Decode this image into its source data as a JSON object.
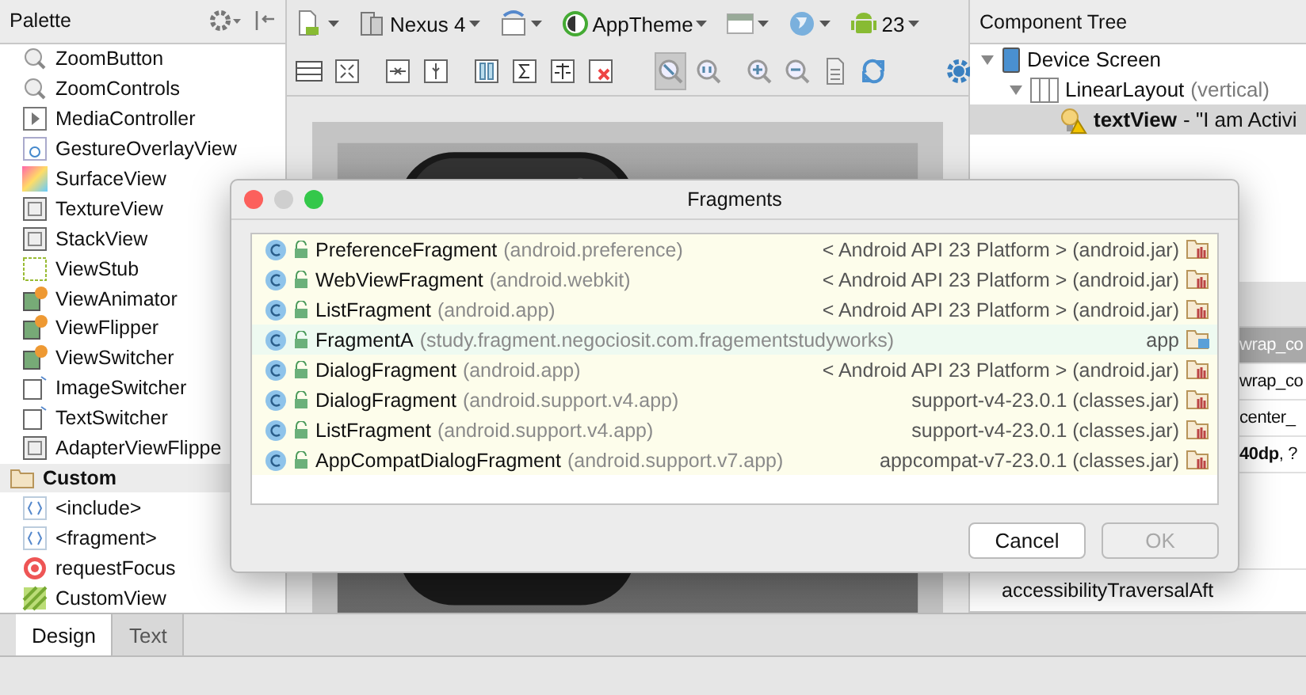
{
  "palette": {
    "title": "Palette",
    "items": [
      {
        "label": "ZoomButton",
        "kind": "zoom"
      },
      {
        "label": "ZoomControls",
        "kind": "zoom"
      },
      {
        "label": "MediaController",
        "kind": "media"
      },
      {
        "label": "GestureOverlayView",
        "kind": "gesture"
      },
      {
        "label": "SurfaceView",
        "kind": "surface"
      },
      {
        "label": "TextureView",
        "kind": "texture"
      },
      {
        "label": "StackView",
        "kind": "stack"
      },
      {
        "label": "ViewStub",
        "kind": "stub"
      },
      {
        "label": "ViewAnimator",
        "kind": "animator"
      },
      {
        "label": "ViewFlipper",
        "kind": "animator"
      },
      {
        "label": "ViewSwitcher",
        "kind": "animator"
      },
      {
        "label": "ImageSwitcher",
        "kind": "switcher"
      },
      {
        "label": "TextSwitcher",
        "kind": "switcher"
      },
      {
        "label": "AdapterViewFlippe",
        "kind": "texture"
      },
      {
        "label": "Custom",
        "kind": "section"
      },
      {
        "label": "<include>",
        "kind": "include"
      },
      {
        "label": "<fragment>",
        "kind": "include"
      },
      {
        "label": "requestFocus",
        "kind": "focus"
      },
      {
        "label": "CustomView",
        "kind": "custom"
      }
    ]
  },
  "toolbar": {
    "items": [
      {
        "kind": "device"
      },
      {
        "kind": "phone",
        "label": "Nexus 4"
      },
      {
        "kind": "orientation"
      },
      {
        "kind": "theme",
        "label": "AppTheme"
      },
      {
        "kind": "layout"
      },
      {
        "kind": "globe"
      },
      {
        "kind": "android",
        "label": "23"
      }
    ],
    "tools": [
      {
        "kind": "lines",
        "selected": false
      },
      {
        "kind": "expand",
        "selected": false
      },
      {
        "kind": "hsplit",
        "selected": false
      },
      {
        "kind": "vsplit",
        "selected": false
      },
      {
        "kind": "columns",
        "selected": false
      },
      {
        "kind": "sigma",
        "selected": false
      },
      {
        "kind": "scale",
        "selected": false
      },
      {
        "kind": "remove",
        "selected": false
      },
      {
        "kind": "zoomfit",
        "selected": true
      },
      {
        "kind": "zoomactual",
        "selected": false
      },
      {
        "kind": "zoomin",
        "selected": false
      },
      {
        "kind": "zoomout",
        "selected": false
      },
      {
        "kind": "page",
        "selected": false
      },
      {
        "kind": "refresh",
        "selected": false
      },
      {
        "kind": "gear",
        "selected": false
      }
    ]
  },
  "component_tree": {
    "title": "Component Tree",
    "nodes": [
      {
        "label": "Device Screen",
        "kind": "device",
        "expanded": true,
        "selected": false,
        "children": [
          {
            "label": "LinearLayout",
            "detail": "(vertical)",
            "kind": "layout",
            "expanded": true,
            "selected": false,
            "children": [
              {
                "label": "textView",
                "detail": "- \"I am Activi",
                "kind": "text",
                "selected": true
              }
            ]
          }
        ]
      }
    ]
  },
  "properties": {
    "rows": [
      {
        "value": "wrap_co",
        "dimmed": true
      },
      {
        "value": "wrap_co",
        "dimmed": false
      },
      {
        "value": "center_",
        "dimmed": false
      },
      {
        "value": "**40dp**, ?",
        "dimmed": false
      }
    ],
    "footer_row": {
      "name": "accessibilityTraversalAft"
    }
  },
  "editor_tabs": [
    {
      "label": "Design",
      "selected": true
    },
    {
      "label": "Text",
      "selected": false
    }
  ],
  "dialog": {
    "title": "Fragments",
    "rows": [
      {
        "name": "PreferenceFragment",
        "package": "(android.preference)",
        "library": "< Android API 23 Platform > (android.jar)",
        "kind": "jar"
      },
      {
        "name": "WebViewFragment",
        "package": "(android.webkit)",
        "library": "< Android API 23 Platform > (android.jar)",
        "kind": "jar"
      },
      {
        "name": "ListFragment",
        "package": "(android.app)",
        "library": "< Android API 23 Platform > (android.jar)",
        "kind": "jar"
      },
      {
        "name": "FragmentA",
        "package": "(study.fragment.negociosit.com.fragementstudyworks)",
        "library": "app",
        "kind": "module"
      },
      {
        "name": "DialogFragment",
        "package": "(android.app)",
        "library": "< Android API 23 Platform > (android.jar)",
        "kind": "jar"
      },
      {
        "name": "DialogFragment",
        "package": "(android.support.v4.app)",
        "library": "support-v4-23.0.1 (classes.jar)",
        "kind": "jar"
      },
      {
        "name": "ListFragment",
        "package": "(android.support.v4.app)",
        "library": "support-v4-23.0.1 (classes.jar)",
        "kind": "jar"
      },
      {
        "name": "AppCompatDialogFragment",
        "package": "(android.support.v7.app)",
        "library": "appcompat-v7-23.0.1 (classes.jar)",
        "kind": "jar"
      }
    ],
    "buttons": [
      {
        "label": "Cancel",
        "disabled": false
      },
      {
        "label": "OK",
        "disabled": true
      }
    ]
  }
}
